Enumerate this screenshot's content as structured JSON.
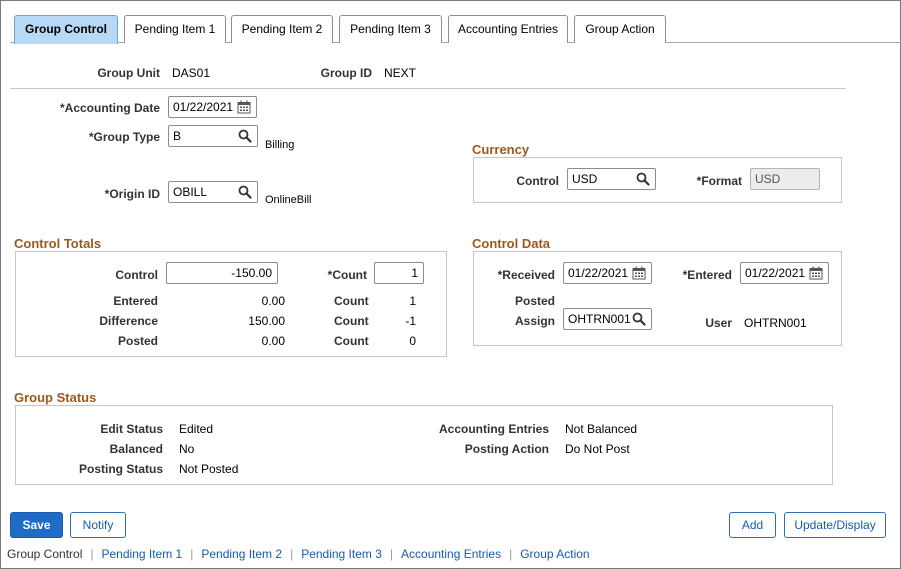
{
  "tabs": [
    {
      "label": "Group Control"
    },
    {
      "label": "Pending Item 1"
    },
    {
      "label": "Pending Item 2"
    },
    {
      "label": "Pending Item 3"
    },
    {
      "label": "Accounting Entries"
    },
    {
      "label": "Group Action"
    }
  ],
  "header": {
    "group_unit_label": "Group Unit",
    "group_unit_value": "DAS01",
    "group_id_label": "Group ID",
    "group_id_value": "NEXT"
  },
  "form": {
    "accounting_date_label": "*Accounting Date",
    "accounting_date_value": "01/22/2021",
    "group_type_label": "*Group Type",
    "group_type_value": "B",
    "group_type_desc": "Billing",
    "origin_id_label": "*Origin ID",
    "origin_id_value": "OBILL",
    "origin_id_desc": "OnlineBill"
  },
  "currency": {
    "title": "Currency",
    "control_label": "Control",
    "control_value": "USD",
    "format_label": "*Format",
    "format_value": "USD"
  },
  "control_totals": {
    "title": "Control Totals",
    "control_label": "Control",
    "control_value": "-150.00",
    "count_label": "*Count",
    "count_value": "1",
    "entered_label": "Entered",
    "entered_amount": "0.00",
    "entered_count_label": "Count",
    "entered_count": "1",
    "difference_label": "Difference",
    "difference_amount": "150.00",
    "difference_count_label": "Count",
    "difference_count": "-1",
    "posted_label": "Posted",
    "posted_amount": "0.00",
    "posted_count_label": "Count",
    "posted_count": "0"
  },
  "control_data": {
    "title": "Control Data",
    "received_label": "*Received",
    "received_value": "01/22/2021",
    "entered_label": "*Entered",
    "entered_value": "01/22/2021",
    "posted_label": "Posted",
    "assign_label": "Assign",
    "assign_value": "OHTRN001",
    "user_label": "User",
    "user_value": "OHTRN001"
  },
  "group_status": {
    "title": "Group Status",
    "edit_status_label": "Edit Status",
    "edit_status_value": "Edited",
    "balanced_label": "Balanced",
    "balanced_value": "No",
    "posting_status_label": "Posting Status",
    "posting_status_value": "Not Posted",
    "accounting_entries_label": "Accounting Entries",
    "accounting_entries_value": "Not Balanced",
    "posting_action_label": "Posting Action",
    "posting_action_value": "Do Not Post"
  },
  "buttons": {
    "save": "Save",
    "notify": "Notify",
    "add": "Add",
    "update_display": "Update/Display"
  },
  "footer": {
    "current": "Group Control",
    "links": [
      "Pending Item 1",
      "Pending Item 2",
      "Pending Item 3",
      "Accounting Entries",
      "Group Action"
    ],
    "separator": "|"
  },
  "icons": {
    "calendar": "calendar-icon",
    "search": "search-icon"
  },
  "colors": {
    "active_tab": "#b7d9f5",
    "section_title": "#9a5a1f",
    "primary_button": "#1f6bc5",
    "link": "#1a5aa8"
  }
}
